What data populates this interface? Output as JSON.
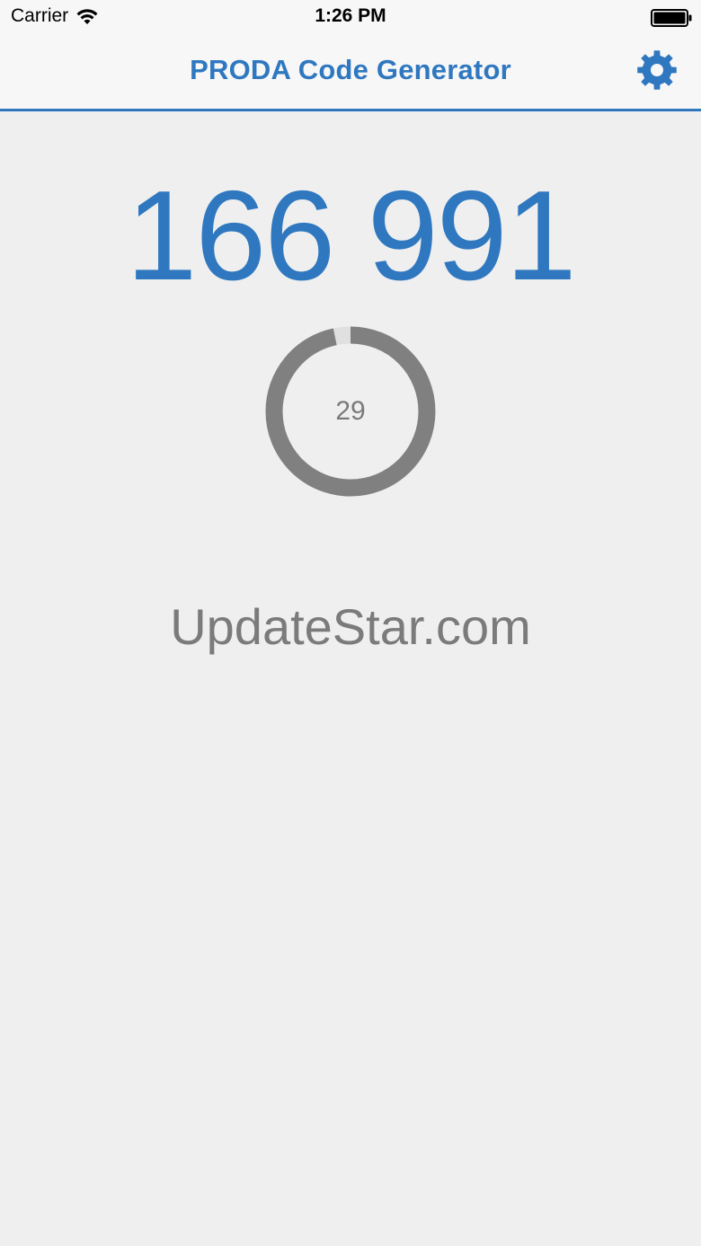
{
  "status_bar": {
    "carrier": "Carrier",
    "time": "1:26 PM",
    "wifi_icon": "wifi-icon",
    "battery_icon": "battery-icon"
  },
  "nav": {
    "title": "PRODA Code Generator",
    "settings_icon": "gear-icon"
  },
  "code": {
    "value": "166 991"
  },
  "timer": {
    "seconds_remaining": "29",
    "period_seconds": 30,
    "elapsed_fraction": 0.033
  },
  "footer": {
    "brand": "UpdateStar.com"
  },
  "colors": {
    "accent": "#2f78c0",
    "background": "#efefef",
    "ring": "#808080",
    "ring_track": "#e0e0e0"
  }
}
